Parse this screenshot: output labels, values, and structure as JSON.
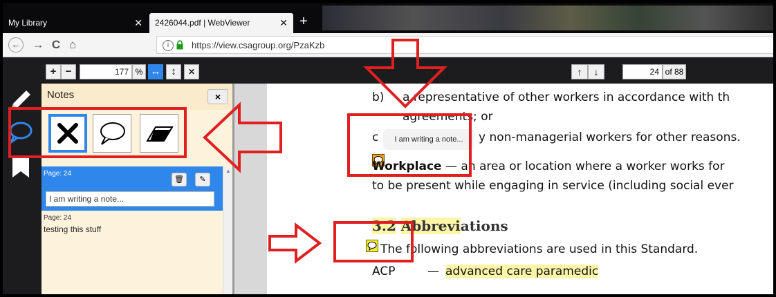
{
  "browser": {
    "tabs": [
      {
        "label": "My Library",
        "close": "✕"
      },
      {
        "label": "2426044.pdf | WebViewer",
        "close": "✕"
      }
    ],
    "new_tab": "+",
    "nav": {
      "back": "←",
      "forward": "→",
      "reload": "C",
      "home": "⌂"
    },
    "url": "https://view.csagroup.org/PzaKzb",
    "url_info": "i"
  },
  "viewer_toolbar": {
    "zoom_in": "+",
    "zoom_out": "−",
    "zoom_value": "177",
    "zoom_unit": "%",
    "fit_width": "↔",
    "fit_height": "↕",
    "fullscreen": "✕",
    "prev_page": "↑",
    "next_page": "↓",
    "page_value": "24",
    "page_total": "of 88"
  },
  "notes_panel": {
    "title": "Notes",
    "close": "×",
    "tools": [
      "delete-tool",
      "comment-tool",
      "eraser-tool"
    ],
    "notes": [
      {
        "page": "Page: 24",
        "delete": "🗑",
        "edit": "✎",
        "text": "I am writing a note..."
      },
      {
        "page": "Page: 24",
        "text": "testing this stuff"
      }
    ]
  },
  "document": {
    "line1_prefix": "b)",
    "line1_text": "a representative of other workers in accordance with th",
    "line2_text": "agreements; or",
    "line3_prefix": "c",
    "line3_text": "y non-managerial workers for other reasons.",
    "tooltip": "I am writing a note...",
    "workplace_term": "Workplace",
    "workplace_def": " — an area or location where a worker works for",
    "workplace_line2": "to be present while engaging in service (including social ever",
    "section_number": "3.2",
    "section_title_hl": "Abbrevi",
    "section_title_rest": "ations",
    "abbrev_intro": "The following abbreviations are used in this Standard.",
    "abbrev_term": "ACP",
    "abbrev_dash": "—",
    "abbrev_def": "advanced care paramedic"
  },
  "colors": {
    "accent_blue": "#2f87ec",
    "annotation_red": "#e02020",
    "highlight_yellow": "#fbf5a8",
    "notes_bg": "#fdf2dc"
  }
}
